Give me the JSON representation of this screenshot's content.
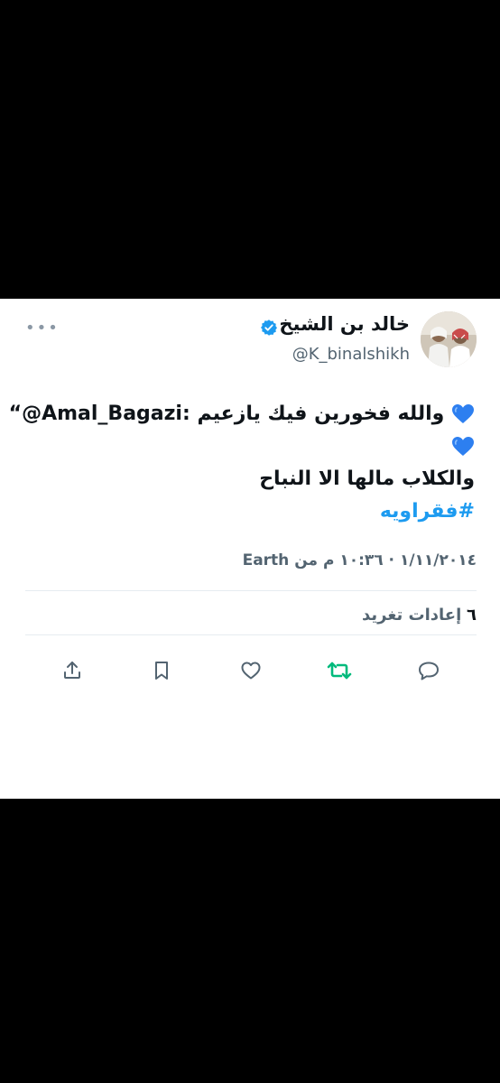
{
  "tweet": {
    "more_icon": "more-horizontal-icon",
    "author": {
      "name": "خالد بن الشيخ",
      "handle": "@K_binalshikh",
      "verified_icon": "verified-badge-icon"
    },
    "body": {
      "quote_prefix": "“@Amal_Bagazi:",
      "line1_text": "والله فخورين فيك يازعيم",
      "line3_text": "والكلاب مالها الا النباح",
      "hashtag": "#فقراويه",
      "emoji": "blue-heart-emoji"
    },
    "meta": "١/١١/٢٠١٤ · ١٠:٣٦ م من Earth",
    "retweets": {
      "count": "٦",
      "label": "إعادات تغريد"
    },
    "actions": [
      "reply-icon",
      "retweet-icon",
      "like-icon",
      "bookmark-icon",
      "share-icon"
    ],
    "colors": {
      "accent": "#1d9bf0",
      "retweet": "#00ba7c",
      "heart": "#2d7ff0"
    }
  }
}
